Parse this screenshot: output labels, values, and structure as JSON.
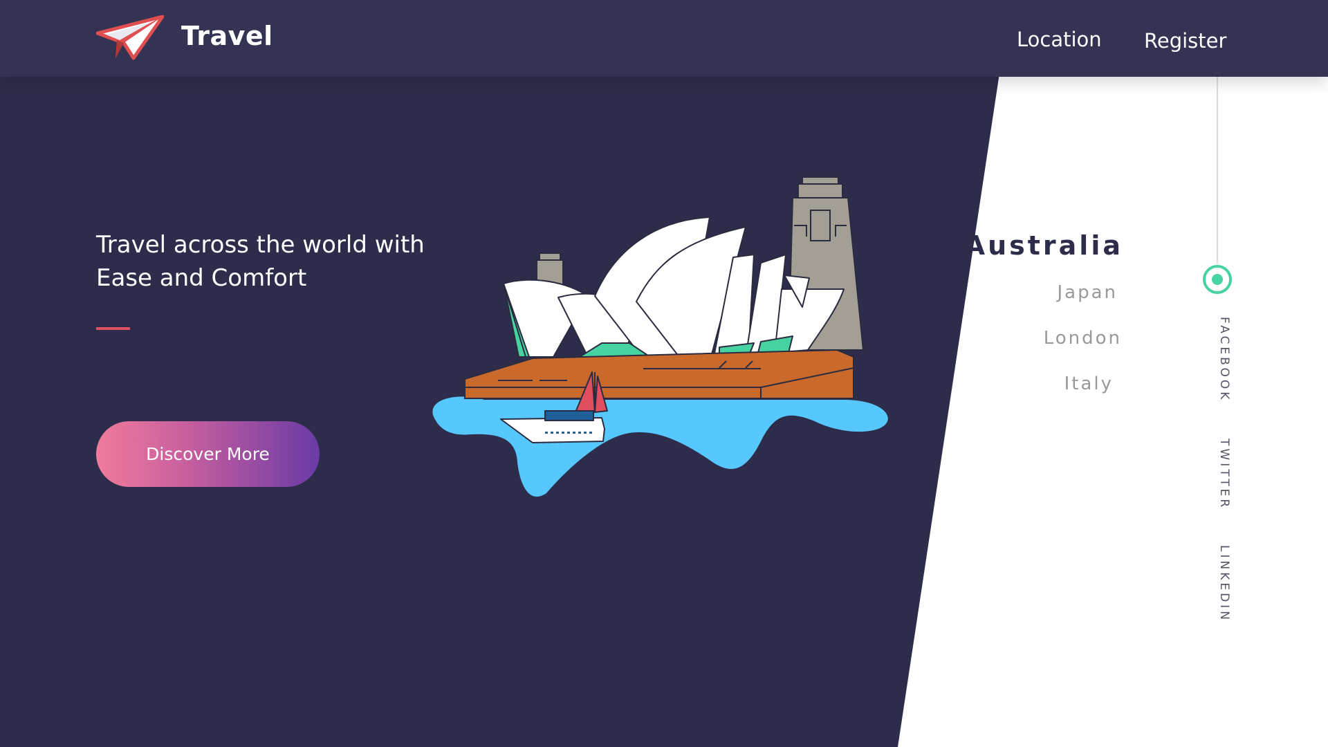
{
  "header": {
    "brand": "Travel",
    "nav": {
      "location": "Location",
      "register": "Register"
    }
  },
  "hero": {
    "title": "Travel across the world with\nEase and Comfort",
    "cta_label": "Discover More"
  },
  "locations": {
    "active": "Australia",
    "items": [
      "Japan",
      "London",
      "Italy"
    ]
  },
  "social": [
    "FACEBOOK",
    "TWITTER",
    "LINKEDIN"
  ],
  "colors": {
    "dark_bg": "#2d2d4b",
    "header_bg": "#343353",
    "accent_red": "#e04f5f",
    "indicator_green": "#47d3a1",
    "water_blue": "#56c8fd",
    "ground_orange": "#c9692b",
    "tower_gray": "#a39f95"
  },
  "icons": {
    "logo": "paper-plane-icon"
  },
  "illustration": "sydney-opera-house"
}
